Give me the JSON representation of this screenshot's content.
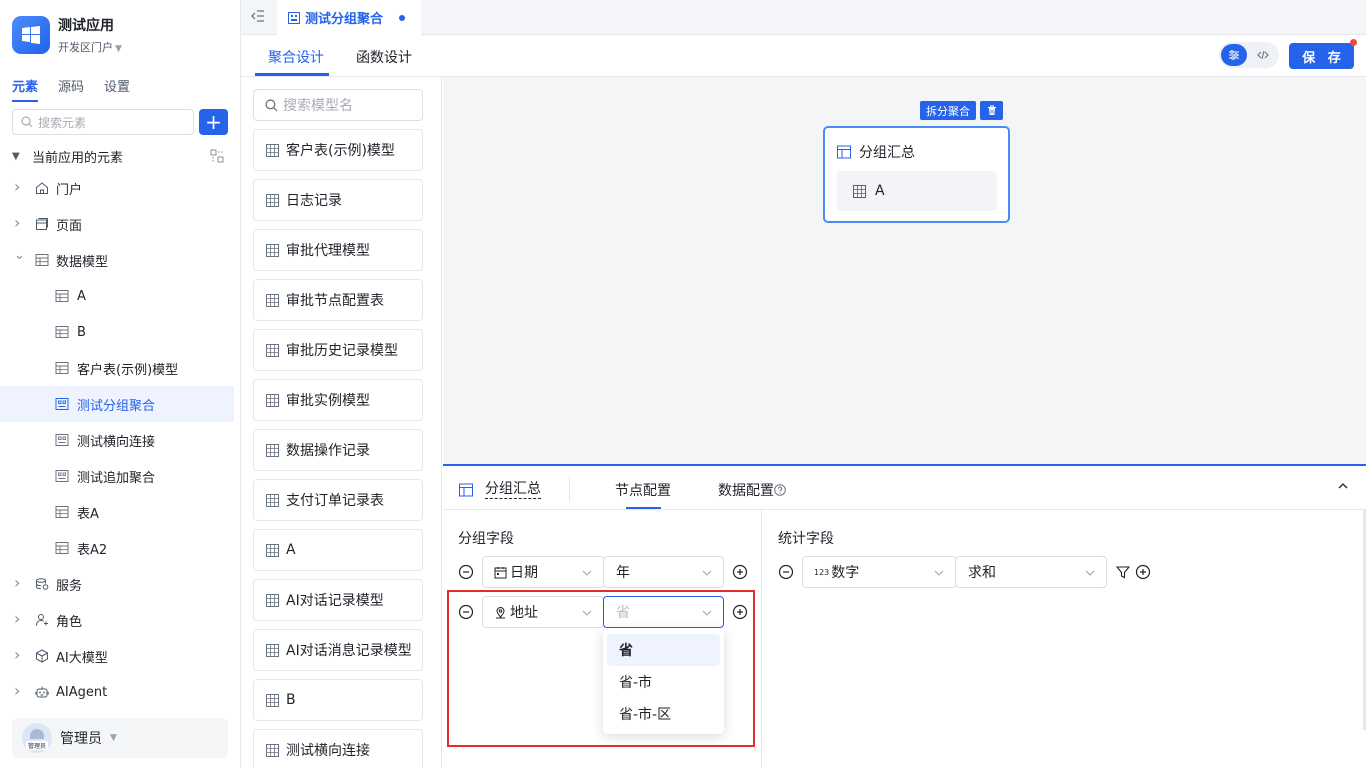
{
  "app": {
    "name": "测试应用",
    "portal": "开发区门户"
  },
  "sidebar": {
    "tabs": [
      "元素",
      "源码",
      "设置"
    ],
    "search_placeholder": "搜索元素",
    "tree_header": "当前应用的元素",
    "items": [
      {
        "label": "门户",
        "icon": "home-icon",
        "level": 1,
        "expandable": true
      },
      {
        "label": "页面",
        "icon": "page-icon",
        "level": 1,
        "expandable": true
      },
      {
        "label": "数据模型",
        "icon": "table-icon",
        "level": 1,
        "expandable": true,
        "expanded": true
      },
      {
        "label": "A",
        "icon": "table-icon",
        "level": 2
      },
      {
        "label": "B",
        "icon": "table-icon",
        "level": 2
      },
      {
        "label": "客户表(示例)模型",
        "icon": "table-icon",
        "level": 2
      },
      {
        "label": "测试分组聚合",
        "icon": "aggregate-icon",
        "level": 2,
        "selected": true
      },
      {
        "label": "测试横向连接",
        "icon": "aggregate-icon",
        "level": 2
      },
      {
        "label": "测试追加聚合",
        "icon": "aggregate-icon",
        "level": 2
      },
      {
        "label": "表A",
        "icon": "table-icon",
        "level": 2
      },
      {
        "label": "表A2",
        "icon": "table-icon",
        "level": 2
      },
      {
        "label": "服务",
        "icon": "service-icon",
        "level": 1,
        "expandable": true
      },
      {
        "label": "角色",
        "icon": "role-icon",
        "level": 1,
        "expandable": true
      },
      {
        "label": "AI大模型",
        "icon": "ai-model-icon",
        "level": 1,
        "expandable": true
      },
      {
        "label": "AIAgent",
        "icon": "robot-icon",
        "level": 1,
        "expandable": true
      }
    ],
    "user": {
      "name": "管理员",
      "avatar_tag": "管理员"
    }
  },
  "topbar": {
    "tab_label": "测试分组聚合"
  },
  "design_tabs": [
    "聚合设计",
    "函数设计"
  ],
  "save_label": "保 存",
  "models": {
    "search_placeholder": "搜索模型名",
    "items": [
      "客户表(示例)模型",
      "日志记录",
      "审批代理模型",
      "审批节点配置表",
      "审批历史记录模型",
      "审批实例模型",
      "数据操作记录",
      "支付订单记录表",
      "A",
      "AI对话记录模型",
      "AI对话消息记录模型",
      "B",
      "测试横向连接"
    ]
  },
  "canvas": {
    "node_action_label": "拆分聚合",
    "node_title": "分组汇总",
    "node_child": "A"
  },
  "config": {
    "title": "分组汇总",
    "tabs": [
      "节点配置",
      "数据配置"
    ],
    "group_section": "分组字段",
    "stat_section": "统计字段",
    "group_rows": [
      {
        "field": "日期",
        "field_icon": "calendar-icon",
        "option": "年"
      },
      {
        "field": "地址",
        "field_icon": "location-icon",
        "option_placeholder": "省"
      }
    ],
    "stat_row": {
      "field": "数字",
      "field_icon": "number-icon",
      "func": "求和"
    },
    "dropdown_options": [
      "省",
      "省-市",
      "省-市-区"
    ]
  },
  "colors": {
    "accent": "#2563eb",
    "highlight": "#e52c2c"
  }
}
